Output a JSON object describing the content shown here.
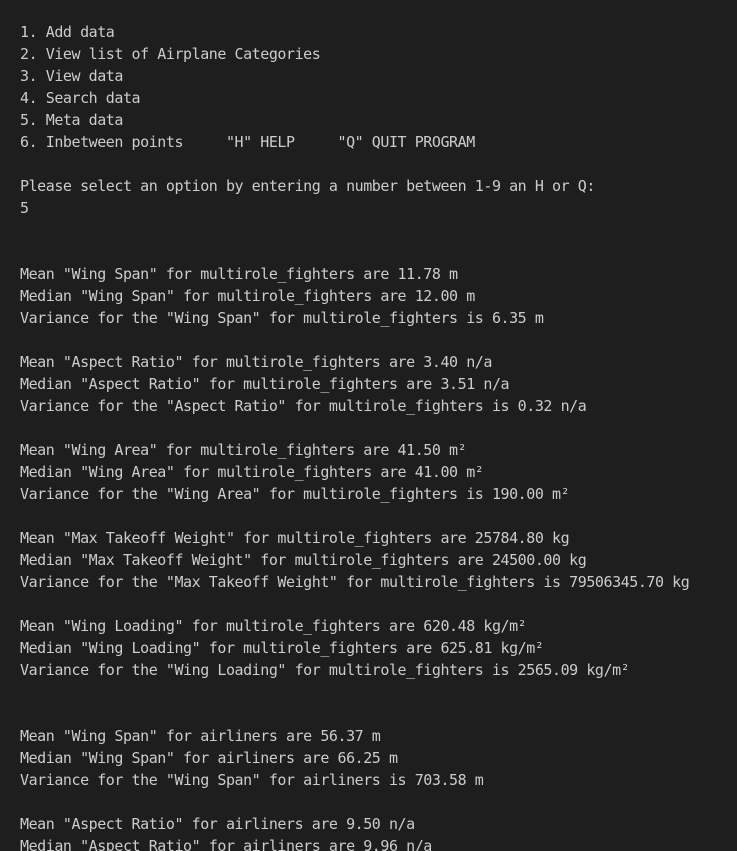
{
  "terminal": {
    "lines": [
      "1. Add data",
      "2. View list of Airplane Categories",
      "3. View data",
      "4. Search data",
      "5. Meta data",
      "6. Inbetween points     \"H\" HELP     \"Q\" QUIT PROGRAM",
      "",
      "Please select an option by entering a number between 1-9 an H or Q:",
      "5",
      "",
      "",
      "Mean \"Wing Span\" for multirole_fighters are 11.78 m",
      "Median \"Wing Span\" for multirole_fighters are 12.00 m",
      "Variance for the \"Wing Span\" for multirole_fighters is 6.35 m",
      "",
      "Mean \"Aspect Ratio\" for multirole_fighters are 3.40 n/a",
      "Median \"Aspect Ratio\" for multirole_fighters are 3.51 n/a",
      "Variance for the \"Aspect Ratio\" for multirole_fighters is 0.32 n/a",
      "",
      "Mean \"Wing Area\" for multirole_fighters are 41.50 m²",
      "Median \"Wing Area\" for multirole_fighters are 41.00 m²",
      "Variance for the \"Wing Area\" for multirole_fighters is 190.00 m²",
      "",
      "Mean \"Max Takeoff Weight\" for multirole_fighters are 25784.80 kg",
      "Median \"Max Takeoff Weight\" for multirole_fighters are 24500.00 kg",
      "Variance for the \"Max Takeoff Weight\" for multirole_fighters is 79506345.70 kg",
      "",
      "Mean \"Wing Loading\" for multirole_fighters are 620.48 kg/m²",
      "Median \"Wing Loading\" for multirole_fighters are 625.81 kg/m²",
      "Variance for the \"Wing Loading\" for multirole_fighters is 2565.09 kg/m²",
      "",
      "",
      "Mean \"Wing Span\" for airliners are 56.37 m",
      "Median \"Wing Span\" for airliners are 66.25 m",
      "Variance for the \"Wing Span\" for airliners is 703.58 m",
      "",
      "Mean \"Aspect Ratio\" for airliners are 9.50 n/a",
      "Median \"Aspect Ratio\" for airliners are 9.96 n/a"
    ]
  },
  "colors": {
    "background": "#1e1e1e",
    "text": "#cccccc"
  }
}
